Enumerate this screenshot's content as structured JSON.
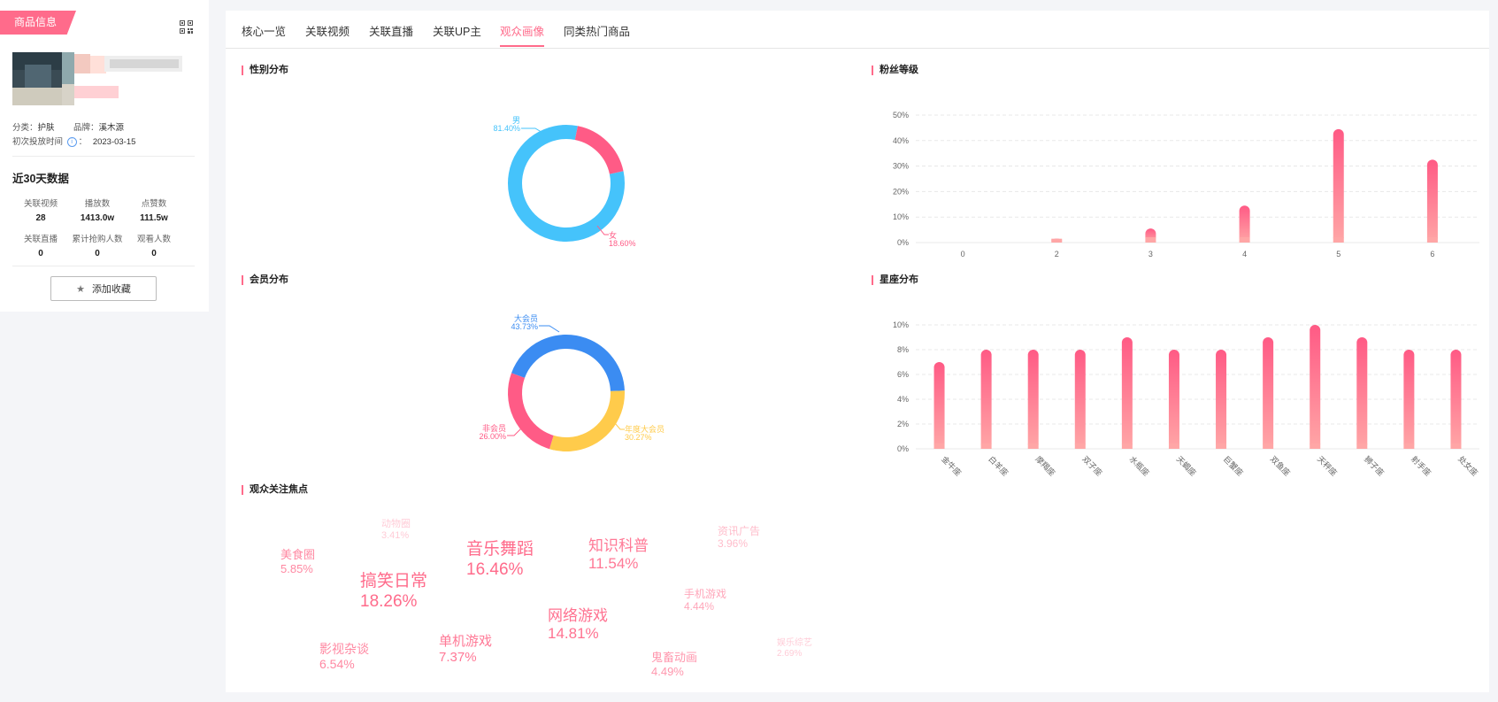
{
  "sidebar": {
    "tag": "商品信息",
    "category_label": "分类：",
    "category_value": "护肤",
    "brand_label": "品牌：",
    "brand_value": "溪木源",
    "first_label": "初次投放时间",
    "first_sep": "：",
    "first_value": "2023-03-15",
    "recent_title": "近30天数据",
    "stats": [
      {
        "label": "关联视频",
        "value": "28"
      },
      {
        "label": "播放数",
        "value": "1413.0w"
      },
      {
        "label": "点赞数",
        "value": "111.5w"
      },
      {
        "label": "关联直播",
        "value": "0"
      },
      {
        "label": "累计抢购人数",
        "value": "0"
      },
      {
        "label": "观看人数",
        "value": "0"
      }
    ],
    "favorite_label": "添加收藏"
  },
  "tabs": [
    "核心一览",
    "关联视频",
    "关联直播",
    "关联UP主",
    "观众画像",
    "同类热门商品"
  ],
  "active_tab": 4,
  "panels": {
    "gender": "性别分布",
    "fan_level": "粉丝等级",
    "member": "会员分布",
    "zodiac": "星座分布",
    "focus": "观众关注焦点"
  },
  "colors": {
    "accent": "#ff6b8b",
    "male": "#45c3fb",
    "female": "#ff5b86",
    "big_member": "#3b8cf2",
    "annual_member": "#ffcb4b",
    "non_member": "#ff5b86",
    "bar_top": "#ff5a85",
    "bar_bottom": "#ffa6a6"
  },
  "chart_data": [
    {
      "type": "pie",
      "name": "gender",
      "slices": [
        {
          "label": "男",
          "pct": "81.40%",
          "value": 81.4
        },
        {
          "label": "女",
          "pct": "18.60%",
          "value": 18.6
        }
      ]
    },
    {
      "type": "bar",
      "name": "fan_level",
      "categories": [
        "0",
        "2",
        "3",
        "4",
        "5",
        "6"
      ],
      "values": [
        0,
        1.5,
        5.5,
        14.5,
        44.5,
        32.5
      ],
      "ylim": [
        0,
        50
      ],
      "yticks": [
        "0%",
        "10%",
        "20%",
        "30%",
        "40%",
        "50%"
      ],
      "grid": true
    },
    {
      "type": "pie",
      "name": "member",
      "slices": [
        {
          "label": "大会员",
          "pct": "43.73%",
          "value": 43.73
        },
        {
          "label": "年度大会员",
          "pct": "30.27%",
          "value": 30.27
        },
        {
          "label": "非会员",
          "pct": "26.00%",
          "value": 26.0
        }
      ]
    },
    {
      "type": "bar",
      "name": "zodiac",
      "categories": [
        "金牛座",
        "白羊座",
        "摩羯座",
        "双子座",
        "水瓶座",
        "天蝎座",
        "巨蟹座",
        "双鱼座",
        "天秤座",
        "狮子座",
        "射手座",
        "处女座"
      ],
      "values": [
        7,
        8,
        8,
        8,
        9,
        8,
        8,
        9,
        10,
        9,
        8,
        8
      ],
      "ylim": [
        0,
        10
      ],
      "yticks": [
        "0%",
        "2%",
        "4%",
        "6%",
        "8%",
        "10%"
      ],
      "grid": true
    }
  ],
  "focus_tags": [
    {
      "name": "动物圈",
      "pct": "3.41%"
    },
    {
      "name": "美食圈",
      "pct": "5.85%"
    },
    {
      "name": "搞笑日常",
      "pct": "18.26%"
    },
    {
      "name": "音乐舞蹈",
      "pct": "16.46%"
    },
    {
      "name": "知识科普",
      "pct": "11.54%"
    },
    {
      "name": "资讯广告",
      "pct": "3.96%"
    },
    {
      "name": "手机游戏",
      "pct": "4.44%"
    },
    {
      "name": "网络游戏",
      "pct": "14.81%"
    },
    {
      "name": "影视杂谈",
      "pct": "6.54%"
    },
    {
      "name": "单机游戏",
      "pct": "7.37%"
    },
    {
      "name": "鬼畜动画",
      "pct": "4.49%"
    },
    {
      "name": "娱乐综艺",
      "pct": "2.69%"
    }
  ]
}
